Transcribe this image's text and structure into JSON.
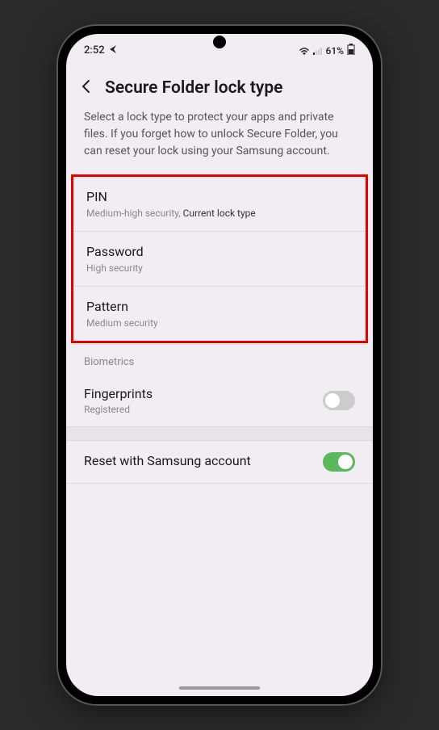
{
  "statusBar": {
    "time": "2:52",
    "battery": "61%"
  },
  "header": {
    "title": "Secure Folder lock type"
  },
  "description": "Select a lock type to protect your apps and private files. If you forget how to unlock Secure Folder, you can reset your lock using your Samsung account.",
  "lockTypes": [
    {
      "title": "PIN",
      "subtitle": "Medium-high security,",
      "current": "Current lock type"
    },
    {
      "title": "Password",
      "subtitle": "High security",
      "current": ""
    },
    {
      "title": "Pattern",
      "subtitle": "Medium security",
      "current": ""
    }
  ],
  "biometricsHeader": "Biometrics",
  "fingerprints": {
    "title": "Fingerprints",
    "subtitle": "Registered",
    "enabled": false
  },
  "resetItem": {
    "title": "Reset with Samsung account",
    "enabled": true
  }
}
